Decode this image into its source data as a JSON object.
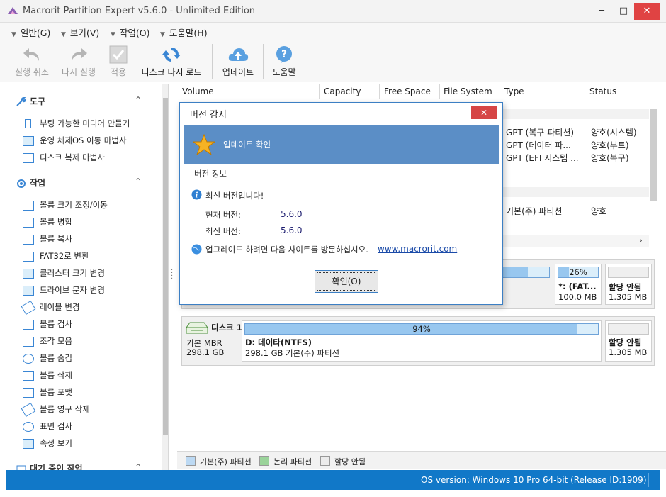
{
  "window": {
    "title": "Macrorit Partition Expert v5.6.0 - Unlimited Edition",
    "min": "─",
    "max": "□",
    "close": "✕"
  },
  "menu": [
    {
      "label": "일반(G)"
    },
    {
      "label": "보기(V)"
    },
    {
      "label": "작업(O)"
    },
    {
      "label": "도움말(H)"
    }
  ],
  "toolbar": {
    "undo": "실행 취소",
    "redo": "다시 실행",
    "apply": "적용",
    "reload": "디스크 다시 로드",
    "update": "업데이트",
    "help": "도움말"
  },
  "sidebar": {
    "tools_head": "도구",
    "tools": [
      {
        "label": "부팅 가능한 미디어 만들기",
        "icon": "usb-icon"
      },
      {
        "label": "운영 체제OS 이동 마법사",
        "icon": "os-migrate-icon"
      },
      {
        "label": "디스크 복제 마법사",
        "icon": "disk-clone-icon"
      }
    ],
    "ops_head": "작업",
    "ops": [
      {
        "label": "볼륨 크기 조정/이동",
        "icon": "resize-icon"
      },
      {
        "label": "볼륨 병합",
        "icon": "merge-icon"
      },
      {
        "label": "볼륨 복사",
        "icon": "copy-icon"
      },
      {
        "label": "FAT32로 변환",
        "icon": "convert-icon"
      },
      {
        "label": "클러스터 크기 변경",
        "icon": "cluster-icon"
      },
      {
        "label": "드라이브 문자 변경",
        "icon": "drive-letter-icon"
      },
      {
        "label": "레이블 변경",
        "icon": "label-icon"
      },
      {
        "label": "볼륨 검사",
        "icon": "check-icon"
      },
      {
        "label": "조각 모음",
        "icon": "defrag-icon"
      },
      {
        "label": "볼륨 숨김",
        "icon": "hide-icon"
      },
      {
        "label": "볼륨 삭제",
        "icon": "delete-icon"
      },
      {
        "label": "볼륨 포맷",
        "icon": "format-icon"
      },
      {
        "label": "볼륨 영구 삭제",
        "icon": "wipe-icon"
      },
      {
        "label": "표면 검사",
        "icon": "surface-test-icon"
      },
      {
        "label": "속성 보기",
        "icon": "properties-icon"
      }
    ],
    "pending_head": "대기 중인 작업",
    "collapse": "⌃"
  },
  "table": {
    "columns": [
      "Volume",
      "Capacity",
      "Free Space",
      "File System",
      "Type",
      "Status"
    ],
    "rows": [
      {
        "type": "GPT (복구 파티션)",
        "status": "양호(시스템)"
      },
      {
        "type": "GPT (데이터 파...",
        "status": "양호(부트)"
      },
      {
        "type": "GPT (EFI 시스템 ...",
        "status": "양호(복구)"
      },
      {
        "type": "기본(주) 파티션",
        "status": "양호"
      }
    ]
  },
  "disks": {
    "disk0": {
      "fat_pct_label": "26%",
      "fat_pct": 26,
      "fat_name": "*: (FAT...",
      "fat_size": "100.0 MB",
      "unalloc_label": "할당 안됨",
      "unalloc_size": "1.305 MB"
    },
    "disk1": {
      "name": "디스크 1",
      "type": "기본 MBR",
      "size": "298.1 GB",
      "pct_label": "94%",
      "pct": 94,
      "part_name": "D: 데이타(NTFS)",
      "part_info": "298.1 GB 기본(주) 파티션",
      "unalloc_label": "할당 안됨",
      "unalloc_size": "1.305 MB"
    }
  },
  "legend": {
    "primary": "기본(주) 파티션",
    "logical": "논리 파티션",
    "unallocated": "할당 안됨",
    "colors": {
      "primary": "#bcd9f3",
      "logical": "#9ad39a",
      "unallocated": "#ececec"
    }
  },
  "status": {
    "os": "OS version: Windows 10 Pro  64-bit  (Release ID:1909)"
  },
  "dialog": {
    "title": "버전 감지",
    "close": "✕",
    "banner": "업데이트 확인",
    "section": "버전 정보",
    "latest_msg": "최신 버전입니다!",
    "current_label": "현재 버전:",
    "current_value": "5.6.0",
    "latest_label": "최신 버전:",
    "latest_value": "5.6.0",
    "upgrade_msg": "업그레이드 하려면 다음 사이트를 방문하십시오.",
    "link": "www.macrorit.com",
    "ok": "확인(O)"
  }
}
